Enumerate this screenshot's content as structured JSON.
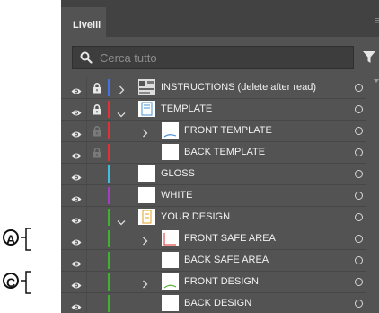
{
  "panel": {
    "tab_label": "Livelli",
    "search_placeholder": "Cerca tutto"
  },
  "layers": [
    {
      "name": "INSTRUCTIONS (delete after read)",
      "color": "#4a6fe0",
      "locked": true,
      "lock_dim": false,
      "expand": "collapsed",
      "indent": 0,
      "thumb": "instr"
    },
    {
      "name": "TEMPLATE",
      "color": "#e0303a",
      "locked": true,
      "lock_dim": false,
      "expand": "expanded",
      "indent": 0,
      "thumb": "template"
    },
    {
      "name": "FRONT TEMPLATE",
      "color": "#e0303a",
      "locked": true,
      "lock_dim": true,
      "expand": "collapsed",
      "indent": 1,
      "thumb": "fronttpl"
    },
    {
      "name": "BACK TEMPLATE",
      "color": "#e0303a",
      "locked": true,
      "lock_dim": true,
      "expand": "none",
      "indent": 1,
      "thumb": "white"
    },
    {
      "name": "GLOSS",
      "color": "#3fbfe0",
      "locked": false,
      "lock_dim": false,
      "expand": "none",
      "indent": 0,
      "thumb": "white"
    },
    {
      "name": "WHITE",
      "color": "#a040c0",
      "locked": false,
      "lock_dim": false,
      "expand": "none",
      "indent": 0,
      "thumb": "white"
    },
    {
      "name": "YOUR DESIGN",
      "color": "#40b030",
      "locked": false,
      "lock_dim": false,
      "expand": "expanded",
      "indent": 0,
      "thumb": "yourdesign"
    },
    {
      "name": "FRONT SAFE AREA",
      "color": "#40b030",
      "locked": false,
      "lock_dim": false,
      "expand": "collapsed",
      "indent": 1,
      "thumb": "frontsafe"
    },
    {
      "name": "BACK SAFE AREA",
      "color": "#40b030",
      "locked": false,
      "lock_dim": false,
      "expand": "none",
      "indent": 1,
      "thumb": "white"
    },
    {
      "name": "FRONT DESIGN",
      "color": "#40b030",
      "locked": false,
      "lock_dim": false,
      "expand": "collapsed",
      "indent": 1,
      "thumb": "frontdesign"
    },
    {
      "name": "BACK DESIGN",
      "color": "#40b030",
      "locked": false,
      "lock_dim": false,
      "expand": "none",
      "indent": 1,
      "thumb": "white"
    }
  ],
  "annotations": [
    {
      "letter": "A",
      "row": 7
    },
    {
      "letter": "C",
      "row": 9
    }
  ]
}
